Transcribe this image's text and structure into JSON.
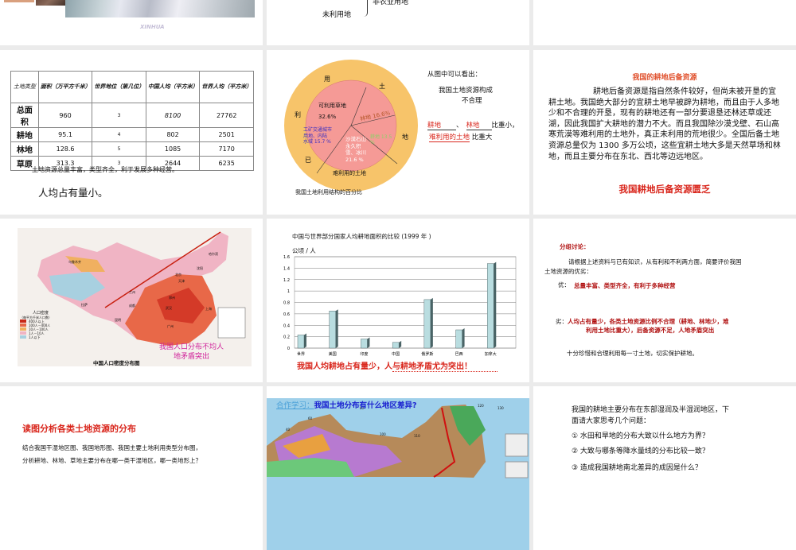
{
  "slides": {
    "s0a": {
      "watermark": "XINHUA"
    },
    "s0b": {
      "item1": "非农业用地",
      "item2": "未利用地"
    },
    "s1": {
      "table": {
        "headers": [
          "土地类型",
          "面积（万平方千米）",
          "世界地位（第几位）",
          "中国人均（平方米）",
          "世界人均（平方米）"
        ],
        "rows": [
          [
            "总面积",
            "960",
            "3",
            "8100",
            "27762"
          ],
          [
            "耕地",
            "95.1",
            "4",
            "802",
            "2501"
          ],
          [
            "林地",
            "128.6",
            "5",
            "1085",
            "7170"
          ],
          [
            "草原",
            "313.3",
            "3",
            "2644",
            "6235"
          ]
        ]
      },
      "note": "土地资源总量丰富，类型齐全，利于发展多种经营。",
      "conclusion": "人均占有量小。"
    },
    "s2": {
      "outer_labels": [
        "用",
        "土",
        "地",
        "已",
        "利"
      ],
      "segments": {
        "grass": "可利用草地",
        "grass_pct": "32.6%",
        "forest": "林地 16.6%",
        "farmland": "耕地 13.5 %",
        "desert": [
          "沙漠石山",
          "永久积",
          "雪、冰川",
          "21.6 %"
        ],
        "urban": [
          "工矿交通城市",
          "用地、内陆",
          "水域 15.7 %"
        ],
        "hard": "难利用的土地"
      },
      "caption": "我国土地利用结构的百分比",
      "side_title": "从图中可以看出：",
      "side_line1": "我国土地资源构成",
      "side_line2": "不合理",
      "blank1": "耕地",
      "sep": "、",
      "blank2": "林地",
      "small": "比重小，",
      "blank3": "难利用的土地",
      "large": "比重大"
    },
    "s3": {
      "title": "我国的耕地后备资源",
      "body": "耕地后备资源是指自然条件较好，但尚未被开垦的宜耕土地。我国绝大部分的宜耕土地早被辟为耕地，而且由于人多地少和不合理的开垦，现有的耕地还有一部分要退垦还林还草或还湖，因此我国扩大耕地的潜力不大。而且我国除沙漠戈壁、石山高寒荒漠等难利用的土地外，真正未利用的荒地很少。全国后备土地资源总量仅为 1300 多万公顷，这些宜耕土地大多是天然草场和林地，而且主要分布在东北、西北等边远地区。",
      "conclusion": "我国耕地后备资源匮乏"
    },
    "s4": {
      "map_title": "中国人口密度分布图",
      "legend_title": "人口密度",
      "legend_sub": "（每平方千米人口数）",
      "legend": [
        "400人以上",
        "100人－400人",
        "10人－100人",
        "1人－10人",
        "1人以下"
      ],
      "cities": [
        "乌鲁木齐",
        "哈尔滨",
        "沈阳",
        "北京",
        "天津",
        "兰州",
        "郑州",
        "上海",
        "成都",
        "武汉",
        "拉萨",
        "昆明",
        "广州"
      ],
      "overlay": [
        "我国人口分布不均人",
        "地矛盾突出"
      ]
    },
    "s5": {
      "caption": "我国人均耕地占有量少，人与耕地矛盾尤为突出！"
    },
    "s6": {
      "title": "分组讨论：",
      "prompt1": "请根据上述资料与已有知识，从有利和不利两方面，简要评价我国",
      "prompt2": "土地资源的优劣：",
      "pro_label": "优：",
      "pro": "总量丰富、类型齐全，有利于多种经营",
      "con_label": "劣：",
      "con1": "人均占有量少，各类土地资源比例不合理（耕地、林地少，难",
      "con2": "利用土地比重大），后备资源不足，人地矛盾突出",
      "closing": "十分珍惜和合理利用每一寸土地，切实保护耕地。"
    },
    "s7": {
      "title": "读图分析各类土地资源的分布",
      "line1": "结合我国干湿地区图、我国地形图、我国主要土地利用类型分布图，",
      "line2": "分析耕地、林地、草地主要分布在哪一类干湿地区，哪一类地形上？"
    },
    "s8": {
      "prefix": "合作学习：",
      "title": "我国土地分布有什么地区差异?",
      "ticks": [
        "40",
        "60",
        "80",
        "100",
        "110",
        "120",
        "130"
      ]
    },
    "s9": {
      "intro1": "我国的耕地主要分布在东部湿润及半湿润地区，下",
      "intro2": "面请大家思考几个问题：",
      "q1": "① 水田和旱地的分布大致以什么地方为界？",
      "q2": "② 大致与哪条等降水量线的分布比较一致？",
      "q3": "③ 造成我国耕地南北差异的成因是什么？"
    }
  },
  "chart_data": {
    "type": "bar",
    "title": "中国与世界部分国家人均耕地面积的比较 (1999 年 )",
    "ylabel": "公顷 / 人",
    "xlabel": "",
    "categories": [
      "世界",
      "美国",
      "印度",
      "中国",
      "俄罗斯",
      "巴西",
      "加拿大"
    ],
    "values": [
      0.23,
      0.65,
      0.16,
      0.1,
      0.85,
      0.32,
      1.48
    ],
    "ylim": [
      0,
      1.6
    ],
    "yticks": [
      "0",
      "0.2",
      "0.4",
      "0.6",
      "0.8",
      "1",
      "1.2",
      "1.4",
      "1.6"
    ],
    "grid": true,
    "bar_color": "#b9dde0"
  },
  "colors": {
    "gap": "#ebebeb",
    "red": "#d9261c",
    "pie_outer": "#f7c46a",
    "pie_inner": "#f59a96"
  }
}
